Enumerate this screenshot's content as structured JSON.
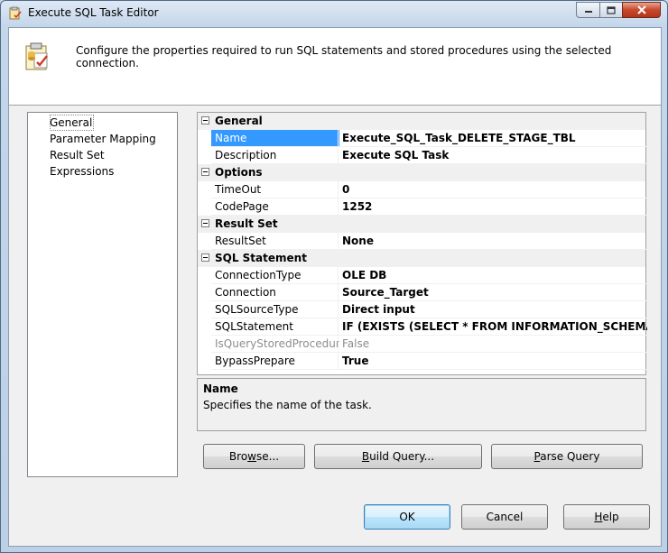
{
  "window": {
    "title": "Execute SQL Task Editor"
  },
  "header": {
    "description": "Configure the properties required to run SQL statements and stored procedures using the selected connection."
  },
  "nav": {
    "items": [
      {
        "label": "General",
        "selected": true
      },
      {
        "label": "Parameter Mapping",
        "selected": false
      },
      {
        "label": "Result Set",
        "selected": false
      },
      {
        "label": "Expressions",
        "selected": false
      }
    ]
  },
  "grid": {
    "categories": {
      "general": "General",
      "options": "Options",
      "result_set": "Result Set",
      "sql_statement": "SQL Statement"
    },
    "props": {
      "name": {
        "label": "Name",
        "value": "Execute_SQL_Task_DELETE_STAGE_TBL"
      },
      "description": {
        "label": "Description",
        "value": "Execute SQL Task"
      },
      "timeout": {
        "label": "TimeOut",
        "value": "0"
      },
      "codepage": {
        "label": "CodePage",
        "value": "1252"
      },
      "resultset": {
        "label": "ResultSet",
        "value": "None"
      },
      "connectiontype": {
        "label": "ConnectionType",
        "value": "OLE DB"
      },
      "connection": {
        "label": "Connection",
        "value": "Source_Target"
      },
      "sqlsourcetype": {
        "label": "SQLSourceType",
        "value": "Direct input"
      },
      "sqlstatement": {
        "label": "SQLStatement",
        "value": "IF (EXISTS (SELECT * FROM INFORMATION_SCHEMA.TABLES"
      },
      "isquerystoredprocedure": {
        "label": "IsQueryStoredProcedure",
        "value": "False"
      },
      "bypassprepare": {
        "label": "BypassPrepare",
        "value": "True"
      }
    }
  },
  "description_panel": {
    "title": "Name",
    "text": "Specifies the name of the task."
  },
  "buttons": {
    "browse": {
      "mnemonic": "w",
      "before": "Bro",
      "after": "se..."
    },
    "build_query": {
      "mnemonic": "B",
      "before": "",
      "after": "uild Query..."
    },
    "parse_query": {
      "mnemonic": "P",
      "before": "",
      "after": "arse Query"
    },
    "ok": "OK",
    "cancel": "Cancel",
    "help": {
      "mnemonic": "H",
      "before": "",
      "after": "elp"
    }
  },
  "colors": {
    "selection": "#3399ff",
    "readonly_text": "#8d8d8d",
    "close_button": "#c9472b"
  }
}
